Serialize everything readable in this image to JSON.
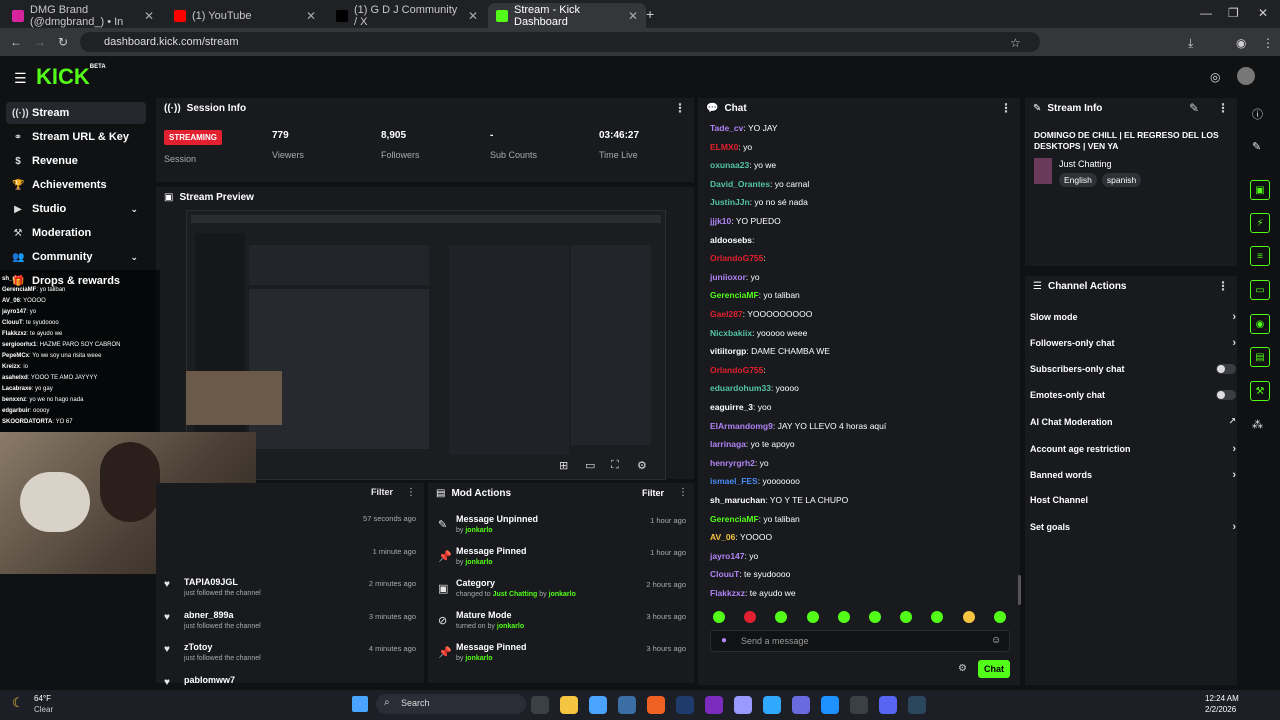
{
  "browser": {
    "tabs": [
      {
        "label": "DMG Brand (@dmgbrand_) • In",
        "color": "#d6249f"
      },
      {
        "label": "(1) YouTube",
        "color": "#ff0000"
      },
      {
        "label": "(1) G D J Community / X",
        "color": "#000000"
      },
      {
        "label": "Stream - Kick Dashboard",
        "color": "#53fc18"
      }
    ],
    "url": "dashboard.kick.com/stream"
  },
  "app": {
    "logo": "KICK",
    "logo_badge": "BETA",
    "sidebar": [
      {
        "label": "Stream",
        "icon": "broadcast-icon"
      },
      {
        "label": "Stream URL & Key",
        "icon": "link-icon"
      },
      {
        "label": "Revenue",
        "icon": "dollar-icon"
      },
      {
        "label": "Achievements",
        "icon": "trophy-icon"
      },
      {
        "label": "Studio",
        "icon": "studio-icon"
      },
      {
        "label": "Moderation",
        "icon": "hammer-icon"
      },
      {
        "label": "Community",
        "icon": "users-icon"
      },
      {
        "label": "Drops & rewards",
        "icon": "gift-icon"
      }
    ],
    "session": {
      "title": "Session Info",
      "status": "STREAMING",
      "status_label": "Session",
      "viewers": "779",
      "viewers_label": "Viewers",
      "followers": "8,905",
      "followers_label": "Followers",
      "subs": "-",
      "subs_label": "Sub Counts",
      "time": "03:46:27",
      "time_label": "Time Live"
    },
    "preview": {
      "title": "Stream Preview"
    },
    "followers_panel": {
      "filter": "Filter",
      "rows": [
        {
          "name": "",
          "sub": "",
          "time": "57 seconds ago"
        },
        {
          "name": "",
          "sub": "",
          "time": "1 minute ago"
        },
        {
          "name": "TAPIA09JGL",
          "sub": "just followed the channel",
          "time": "2 minutes ago"
        },
        {
          "name": "abner_899a",
          "sub": "just followed the channel",
          "time": "3 minutes ago"
        },
        {
          "name": "zTotoy",
          "sub": "just followed the channel",
          "time": "4 minutes ago"
        },
        {
          "name": "pablomww7",
          "sub": "",
          "time": ""
        }
      ]
    },
    "mod_actions": {
      "title": "Mod Actions",
      "filter": "Filter",
      "rows": [
        {
          "title": "Message Unpinned",
          "pre": "by",
          "user": "jonkarlo",
          "mid": "",
          "post": "",
          "time": "1 hour ago",
          "icon": "unpin-icon"
        },
        {
          "title": "Message Pinned",
          "pre": "by",
          "user": "jonkarlo",
          "mid": "",
          "post": "",
          "time": "1 hour ago",
          "icon": "pin-icon"
        },
        {
          "title": "Category",
          "pre": "changed to",
          "user": "Just Chatting",
          "mid": " by ",
          "post": "jonkarlo",
          "time": "2 hours ago",
          "icon": "category-icon"
        },
        {
          "title": "Mature Mode",
          "pre": "turned on by",
          "user": "jonkarlo",
          "mid": "",
          "post": "",
          "time": "3 hours ago",
          "icon": "mature-icon"
        },
        {
          "title": "Message Pinned",
          "pre": "by",
          "user": "jonkarlo",
          "mid": "",
          "post": "",
          "time": "3 hours ago",
          "icon": "pin-icon"
        }
      ]
    },
    "chat": {
      "title": "Chat",
      "placeholder": "Send a message",
      "send": "Chat",
      "messages": [
        {
          "user": "Tade_cv",
          "color": "#b184f5",
          "text": "YO JAY"
        },
        {
          "user": "ELMX0",
          "color": "#e3202f",
          "text": "yo"
        },
        {
          "user": "oxunaa23",
          "color": "#53c4a8",
          "text": "yo we"
        },
        {
          "user": "David_Orantes",
          "color": "#53c4a8",
          "text": "yo carnal"
        },
        {
          "user": "JustinJJn",
          "color": "#53c4a8",
          "text": "yo no sé nada"
        },
        {
          "user": "jjjk10",
          "color": "#b184f5",
          "text": "YO PUEDO"
        },
        {
          "user": "aldoosebs",
          "color": "#ffffff",
          "text": ""
        },
        {
          "user": "OrlandoG755",
          "color": "#e3202f",
          "text": ""
        },
        {
          "user": "juniioxor",
          "color": "#b184f5",
          "text": "yo"
        },
        {
          "user": "GerenciaMF",
          "color": "#53fc18",
          "text": "yo taliban"
        },
        {
          "user": "Gael287",
          "color": "#e3202f",
          "text": "YOOOOOOOOO"
        },
        {
          "user": "Nicxbakiix",
          "color": "#53c4a8",
          "text": "yooooo weee"
        },
        {
          "user": "vitiitorgp",
          "color": "#ffffff",
          "text": "DAME CHAMBA WE"
        },
        {
          "user": "OrlandoG755",
          "color": "#e3202f",
          "text": ""
        },
        {
          "user": "eduardohum33",
          "color": "#53c4a8",
          "text": "yoooo"
        },
        {
          "user": "eaguirre_3",
          "color": "#ffffff",
          "text": "yoo"
        },
        {
          "user": "ElArmandomg9",
          "color": "#b184f5",
          "text": "JAY YO LLEVO 4 horas aquí"
        },
        {
          "user": "larrinaga",
          "color": "#b184f5",
          "text": "yo te apoyo"
        },
        {
          "user": "henryrgrh2",
          "color": "#b184f5",
          "text": "yo"
        },
        {
          "user": "ismael_FES",
          "color": "#4a8cf5",
          "text": "yooooooo"
        },
        {
          "user": "sh_maruchan",
          "color": "#ffffff",
          "text": "YO Y TE LA CHUPO"
        },
        {
          "user": "GerenciaMF",
          "color": "#53fc18",
          "text": "yo taliban"
        },
        {
          "user": "AV_06",
          "color": "#f5c542",
          "text": "YOOOO"
        },
        {
          "user": "jayro147",
          "color": "#b184f5",
          "text": "yo"
        },
        {
          "user": "ClouuT",
          "color": "#b184f5",
          "text": "te syudoooo"
        },
        {
          "user": "Flakkzxz",
          "color": "#b184f5",
          "text": "te ayudo we"
        }
      ]
    },
    "stream_info": {
      "title": "Stream Info",
      "stream_title": "DOMINGO DE CHILL | EL REGRESO DEL LOS DESKTOPS | VEN YA",
      "category": "Just Chatting",
      "tags": [
        "English",
        "spanish"
      ]
    },
    "channel_actions": {
      "title": "Channel Actions",
      "items": [
        {
          "label": "Slow mode",
          "control": "arrow"
        },
        {
          "label": "Followers-only chat",
          "control": "arrow"
        },
        {
          "label": "Subscribers-only chat",
          "control": "toggle"
        },
        {
          "label": "Emotes-only chat",
          "control": "toggle"
        },
        {
          "label": "AI Chat Moderation",
          "control": "external"
        },
        {
          "label": "Account age restriction",
          "control": "arrow"
        },
        {
          "label": "Banned words",
          "control": "arrow"
        },
        {
          "label": "Host Channel",
          "control": "none"
        },
        {
          "label": "Set goals",
          "control": "arrow"
        }
      ]
    },
    "overlay_chat": [
      {
        "user": "sh_m",
        "text": ""
      },
      {
        "user": "GerenciaMF",
        "text": "yo taliban"
      },
      {
        "user": "AV_06",
        "text": "YOOOO"
      },
      {
        "user": "jayro147",
        "text": "yo"
      },
      {
        "user": "ClouuT",
        "text": "te syudoooo"
      },
      {
        "user": "Flakkzxz",
        "text": "te ayudo we"
      },
      {
        "user": "sergioorhx1",
        "text": "HAZME PARO SOY CABRON"
      },
      {
        "user": "PepeMCx",
        "text": "Yo we soy una risita weee"
      },
      {
        "user": "Kreizx",
        "text": "io"
      },
      {
        "user": "asahelxd",
        "text": "YOOO TE AMO JAYYYY"
      },
      {
        "user": "Lacabraxe",
        "text": "yo gay"
      },
      {
        "user": "benxxnz",
        "text": "yo we no hago nada"
      },
      {
        "user": "edgarbuir",
        "text": "ooooy"
      },
      {
        "user": "SKOORDATORTA",
        "text": "YO 67"
      }
    ]
  },
  "taskbar": {
    "weather_temp": "64°F",
    "weather_desc": "Clear",
    "search": "Search",
    "time": "12:24 AM",
    "date": "2/2/2026"
  }
}
